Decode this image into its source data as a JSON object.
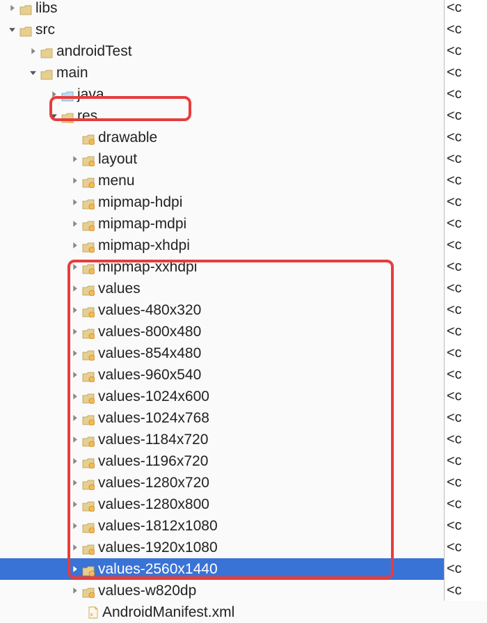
{
  "tree": [
    {
      "indent": 0,
      "arrow": "right",
      "icon": "folder",
      "label": "libs"
    },
    {
      "indent": 0,
      "arrow": "down",
      "icon": "folder",
      "label": "src"
    },
    {
      "indent": 1,
      "arrow": "right",
      "icon": "folder",
      "label": "androidTest"
    },
    {
      "indent": 1,
      "arrow": "down",
      "icon": "folder",
      "label": "main"
    },
    {
      "indent": 2,
      "arrow": "right",
      "icon": "folder-blue",
      "label": "java"
    },
    {
      "indent": 2,
      "arrow": "down",
      "icon": "folder-res",
      "label": "res"
    },
    {
      "indent": 3,
      "arrow": "none",
      "icon": "folder-dot",
      "label": "drawable"
    },
    {
      "indent": 3,
      "arrow": "right",
      "icon": "folder-dot",
      "label": "layout"
    },
    {
      "indent": 3,
      "arrow": "right",
      "icon": "folder-dot",
      "label": "menu"
    },
    {
      "indent": 3,
      "arrow": "right",
      "icon": "folder-dot",
      "label": "mipmap-hdpi"
    },
    {
      "indent": 3,
      "arrow": "right",
      "icon": "folder-dot",
      "label": "mipmap-mdpi"
    },
    {
      "indent": 3,
      "arrow": "right",
      "icon": "folder-dot",
      "label": "mipmap-xhdpi"
    },
    {
      "indent": 3,
      "arrow": "right",
      "icon": "folder-dot",
      "label": "mipmap-xxhdpi"
    },
    {
      "indent": 3,
      "arrow": "right",
      "icon": "folder-dot",
      "label": "values"
    },
    {
      "indent": 3,
      "arrow": "right",
      "icon": "folder-dot",
      "label": "values-480x320"
    },
    {
      "indent": 3,
      "arrow": "right",
      "icon": "folder-dot",
      "label": "values-800x480"
    },
    {
      "indent": 3,
      "arrow": "right",
      "icon": "folder-dot",
      "label": "values-854x480"
    },
    {
      "indent": 3,
      "arrow": "right",
      "icon": "folder-dot",
      "label": "values-960x540"
    },
    {
      "indent": 3,
      "arrow": "right",
      "icon": "folder-dot",
      "label": "values-1024x600"
    },
    {
      "indent": 3,
      "arrow": "right",
      "icon": "folder-dot",
      "label": "values-1024x768"
    },
    {
      "indent": 3,
      "arrow": "right",
      "icon": "folder-dot",
      "label": "values-1184x720"
    },
    {
      "indent": 3,
      "arrow": "right",
      "icon": "folder-dot",
      "label": "values-1196x720"
    },
    {
      "indent": 3,
      "arrow": "right",
      "icon": "folder-dot",
      "label": "values-1280x720"
    },
    {
      "indent": 3,
      "arrow": "right",
      "icon": "folder-dot",
      "label": "values-1280x800"
    },
    {
      "indent": 3,
      "arrow": "right",
      "icon": "folder-dot",
      "label": "values-1812x1080"
    },
    {
      "indent": 3,
      "arrow": "right",
      "icon": "folder-dot",
      "label": "values-1920x1080"
    },
    {
      "indent": 3,
      "arrow": "right",
      "icon": "folder-dot",
      "label": "values-2560x1440",
      "selected": true
    },
    {
      "indent": 3,
      "arrow": "right",
      "icon": "folder-dot",
      "label": "values-w820dp"
    },
    {
      "indent": 2,
      "arrow": "none",
      "icon": "file-xml",
      "label": "AndroidManifest.xml",
      "extraIndent": true
    }
  ],
  "rightText": "<c"
}
